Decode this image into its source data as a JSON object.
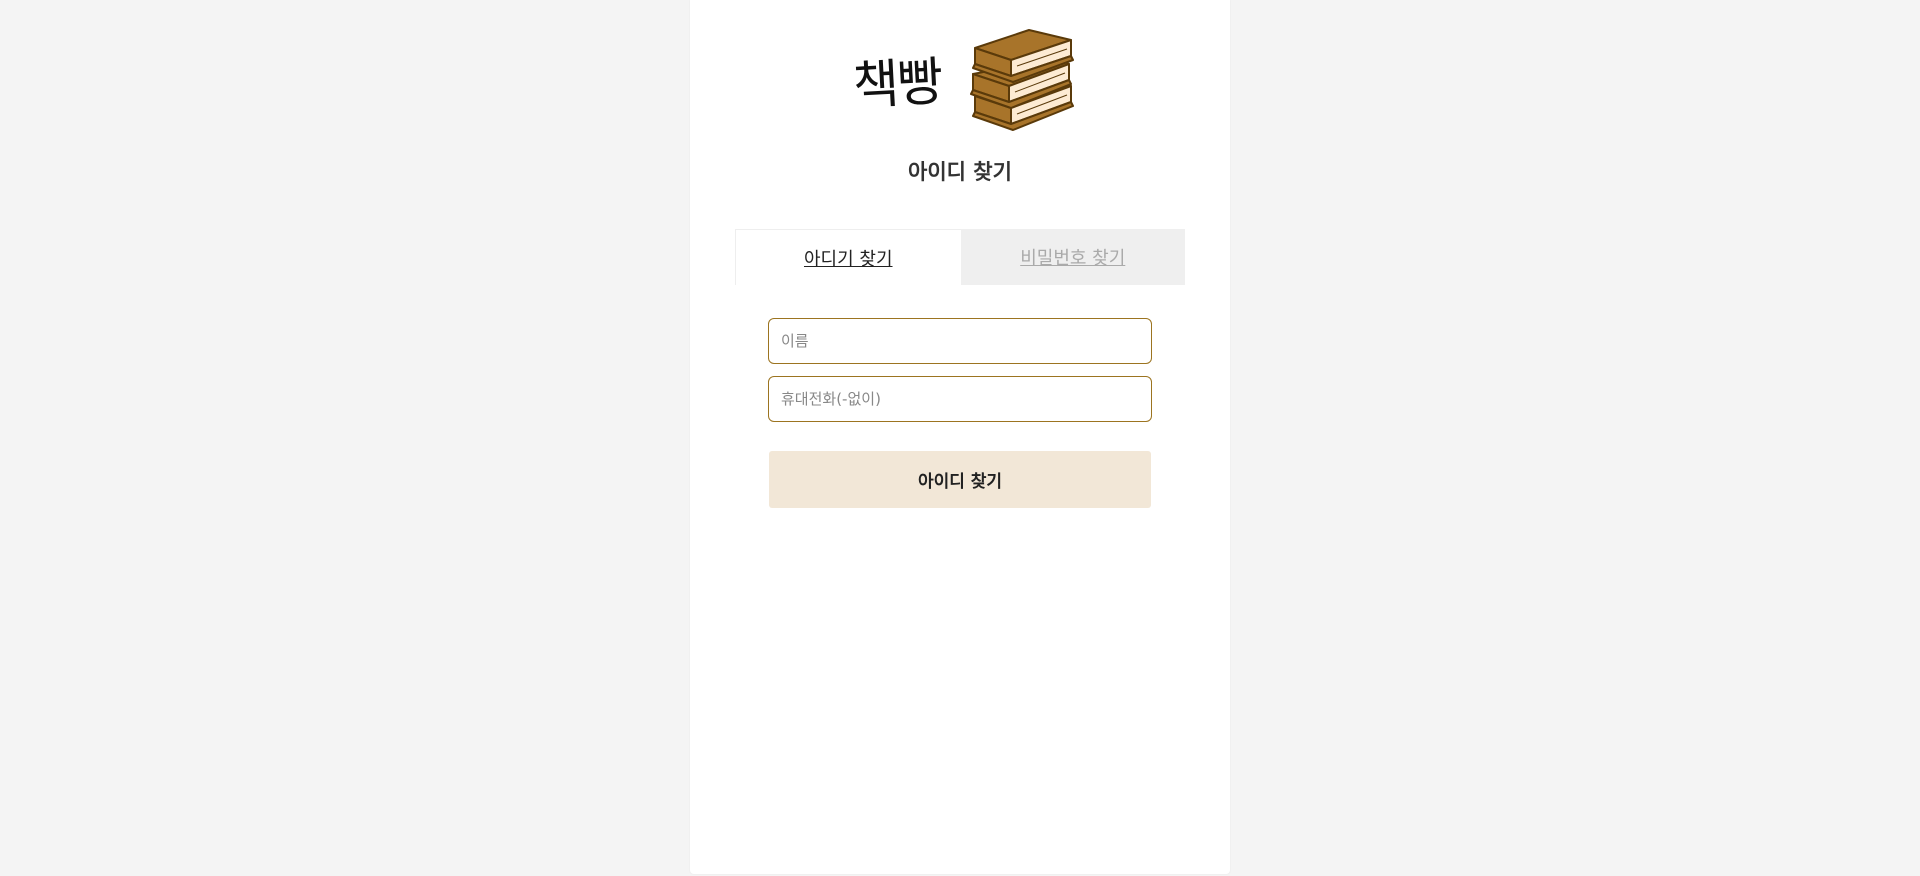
{
  "logo": {
    "text": "책빵",
    "icon": "books-stack-icon"
  },
  "page": {
    "title": "아이디 찾기"
  },
  "tabs": [
    {
      "label": "아디기 찾기",
      "active": true
    },
    {
      "label": "비밀번호 찾기",
      "active": false
    }
  ],
  "form": {
    "name_placeholder": "이름",
    "phone_placeholder": "휴대전화(-없이)",
    "submit_label": "아이디 찾기"
  },
  "colors": {
    "background": "#f4f4f4",
    "card": "#ffffff",
    "input_border": "#9c7420",
    "button_bg": "#f2e7d7",
    "book_cover": "#a8742a",
    "book_pages": "#fdebd3"
  }
}
